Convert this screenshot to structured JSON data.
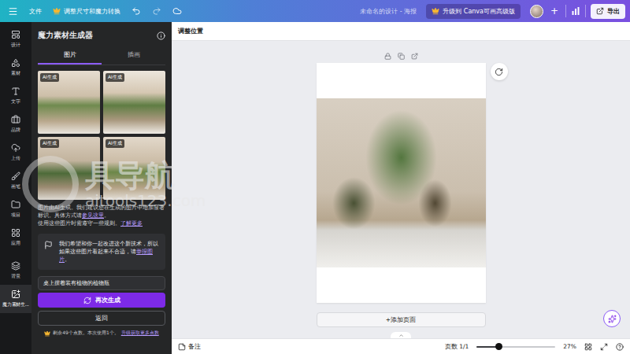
{
  "topbar": {
    "file": "文件",
    "resize": "调整尺寸和魔力转换",
    "title": "未命名的设计 - 海报",
    "upgrade": "升级到 Canva可画高级版",
    "add": "+",
    "export": "导出"
  },
  "rail": [
    {
      "label": "设计",
      "selected": false
    },
    {
      "label": "素材",
      "selected": false
    },
    {
      "label": "文字",
      "selected": false
    },
    {
      "label": "品牌",
      "selected": false
    },
    {
      "label": "上传",
      "selected": false
    },
    {
      "label": "画笔",
      "selected": false
    },
    {
      "label": "项目",
      "selected": false
    },
    {
      "label": "应用",
      "selected": false
    },
    {
      "label": "背景",
      "selected": false
    },
    {
      "label": "魔力素材生...",
      "selected": true
    }
  ],
  "panel": {
    "title": "魔力素材生成器",
    "tabs": [
      {
        "label": "图片",
        "selected": true
      },
      {
        "label": "插画",
        "selected": false
      }
    ],
    "images": [
      {
        "badge": "AI生成"
      },
      {
        "badge": "AI生成"
      },
      {
        "badge": "AI生成"
      },
      {
        "badge": "AI生成"
      }
    ],
    "notice": {
      "text": "图片由AI生成。我们建议您在生成的图片中增加显著标识。具体方式请",
      "link": "参见这里",
      "end": "。"
    },
    "rules": {
      "text": "使用这些图片时需遵守一些规则。",
      "link": "了解更多"
    },
    "feedback": {
      "text": "我们希望和你一起改进这个新技术，所以如果这些图片看起来不合适，请",
      "link": "举报图片",
      "end": "。"
    },
    "prompt": "桌上摆着装有植物的植物瓶",
    "regenerate": "再次生成",
    "back": "返回",
    "credits": {
      "text": "剩余49个点数。本次使用1个。",
      "link": "升级获取更多点数"
    }
  },
  "toolbar": {
    "label": "调整位置"
  },
  "canvas": {
    "add_page": "+添加页面"
  },
  "status_bar": {
    "notes": "备注",
    "pages": "页数 1/1",
    "zoom": {
      "level": 0.28,
      "reading": "27%"
    }
  },
  "watermark": {
    "brand": "具导航",
    "url": "aitools123.com"
  }
}
